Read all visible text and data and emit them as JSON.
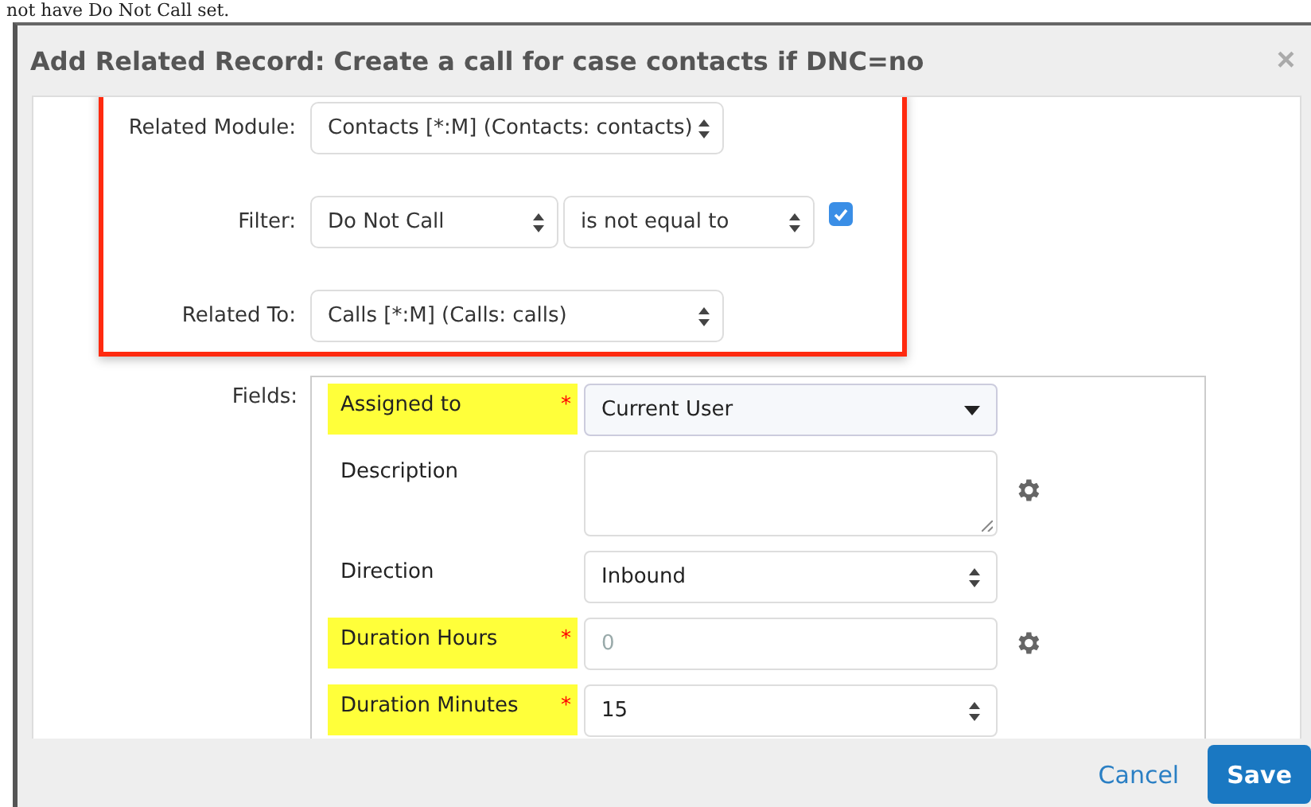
{
  "caption": "not have Do Not Call set.",
  "dialog": {
    "title": "Add Related Record: Create a call for case contacts if DNC=no",
    "close": "×"
  },
  "relation": {
    "module_label": "Related Module:",
    "module_value": "Contacts [*:M] (Contacts: contacts)",
    "filter_label": "Filter:",
    "filter_field": "Do Not Call",
    "filter_operator": "is not equal to",
    "filter_checked": true,
    "related_label": "Related To:",
    "related_value": "Calls [*:M] (Calls: calls)"
  },
  "fields_label": "Fields:",
  "fields": [
    {
      "label": "Assigned to",
      "required": true,
      "mark": "*",
      "kind": "dropdown",
      "value": "Current User",
      "gear": false
    },
    {
      "label": "Description",
      "required": false,
      "kind": "textarea",
      "gear": true
    },
    {
      "label": "Direction",
      "required": false,
      "kind": "select",
      "value": "Inbound",
      "gear": false
    },
    {
      "label": "Duration Hours",
      "required": true,
      "mark": "*",
      "kind": "input",
      "placeholder": "0",
      "gear": true
    },
    {
      "label": "Duration Minutes",
      "required": true,
      "mark": "*",
      "kind": "select",
      "value": "15",
      "gear": false
    }
  ],
  "footer": {
    "cancel": "Cancel",
    "save": "Save"
  }
}
